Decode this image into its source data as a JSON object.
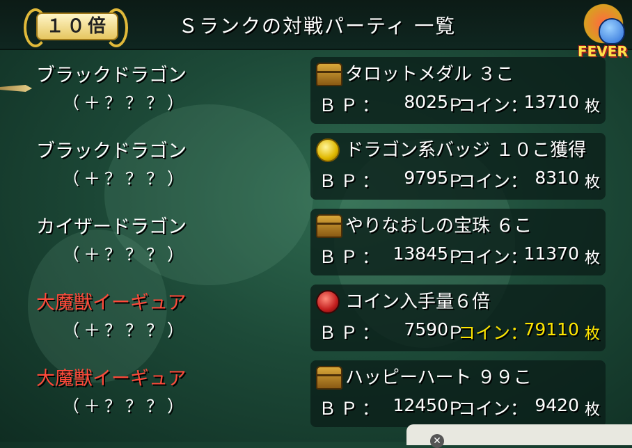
{
  "header": {
    "multiplier": "１０倍",
    "title": "Ｓランクの対戦パーティ 一覧",
    "fever_label": "FEVER"
  },
  "labels": {
    "bp": "ＢＰ：",
    "bp_unit": "Ｐ",
    "coin": "コイン：",
    "coin_unit": "枚"
  },
  "parties": [
    {
      "name": "ブラックドラゴン",
      "level": "（＋？？？）",
      "name_color": "#ffffff",
      "reward_icon": "treasure-chest-icon",
      "reward": "タロットメダル ３こ",
      "bp": "8025",
      "coin": "13710",
      "coin_highlight": false
    },
    {
      "name": "ブラックドラゴン",
      "level": "（＋？？？）",
      "name_color": "#ffffff",
      "reward_icon": "gold-medal-icon",
      "reward": "ドラゴン系バッジ １０こ獲得",
      "bp": "9795",
      "coin": "8310",
      "coin_highlight": false
    },
    {
      "name": "カイザードラゴン",
      "level": "（＋？？？）",
      "name_color": "#ffffff",
      "reward_icon": "treasure-chest-icon",
      "reward": "やりなおしの宝珠 ６こ",
      "bp": "13845",
      "coin": "11370",
      "coin_highlight": false
    },
    {
      "name": "大魔獣イーギュア",
      "level": "（＋？？？）",
      "name_color": "#ff4a3a",
      "reward_icon": "red-gem-icon",
      "reward": "コイン入手量６倍",
      "bp": "7590",
      "coin": "79110",
      "coin_highlight": true
    },
    {
      "name": "大魔獣イーギュア",
      "level": "（＋？？？）",
      "name_color": "#ff4a3a",
      "reward_icon": "treasure-chest-icon",
      "reward": "ハッピーハート ９９こ",
      "bp": "12450",
      "coin": "9420",
      "coin_highlight": false
    }
  ],
  "colors": {
    "accent_yellow": "#ffe600",
    "boss_red": "#ff4a3a"
  }
}
